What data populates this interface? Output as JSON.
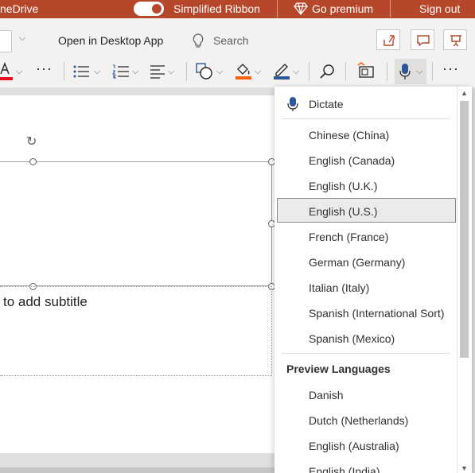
{
  "titlebar": {
    "app_name": "neDrive",
    "toggle_label": "Simplified Ribbon",
    "premium_label": "Go premium",
    "signout_label": "Sign out"
  },
  "commandbar": {
    "open_desktop_label": "Open in Desktop App",
    "search_label": "Search"
  },
  "ribbon": {
    "font_color": "#e81123",
    "highlight_color": "#f7630c",
    "outline_color": "#2b579a"
  },
  "slide": {
    "subtitle_placeholder": "to add subtitle"
  },
  "dictate_menu": {
    "dictate_label": "Dictate",
    "languages": [
      "Chinese (China)",
      "English (Canada)",
      "English (U.K.)",
      "English (U.S.)",
      "French (France)",
      "German (Germany)",
      "Italian (Italy)",
      "Spanish (International Sort)",
      "Spanish (Mexico)"
    ],
    "selected_language": "English (U.S.)",
    "preview_header": "Preview Languages",
    "preview_languages": [
      "Danish",
      "Dutch (Netherlands)",
      "English (Australia)",
      "English (India)"
    ]
  }
}
